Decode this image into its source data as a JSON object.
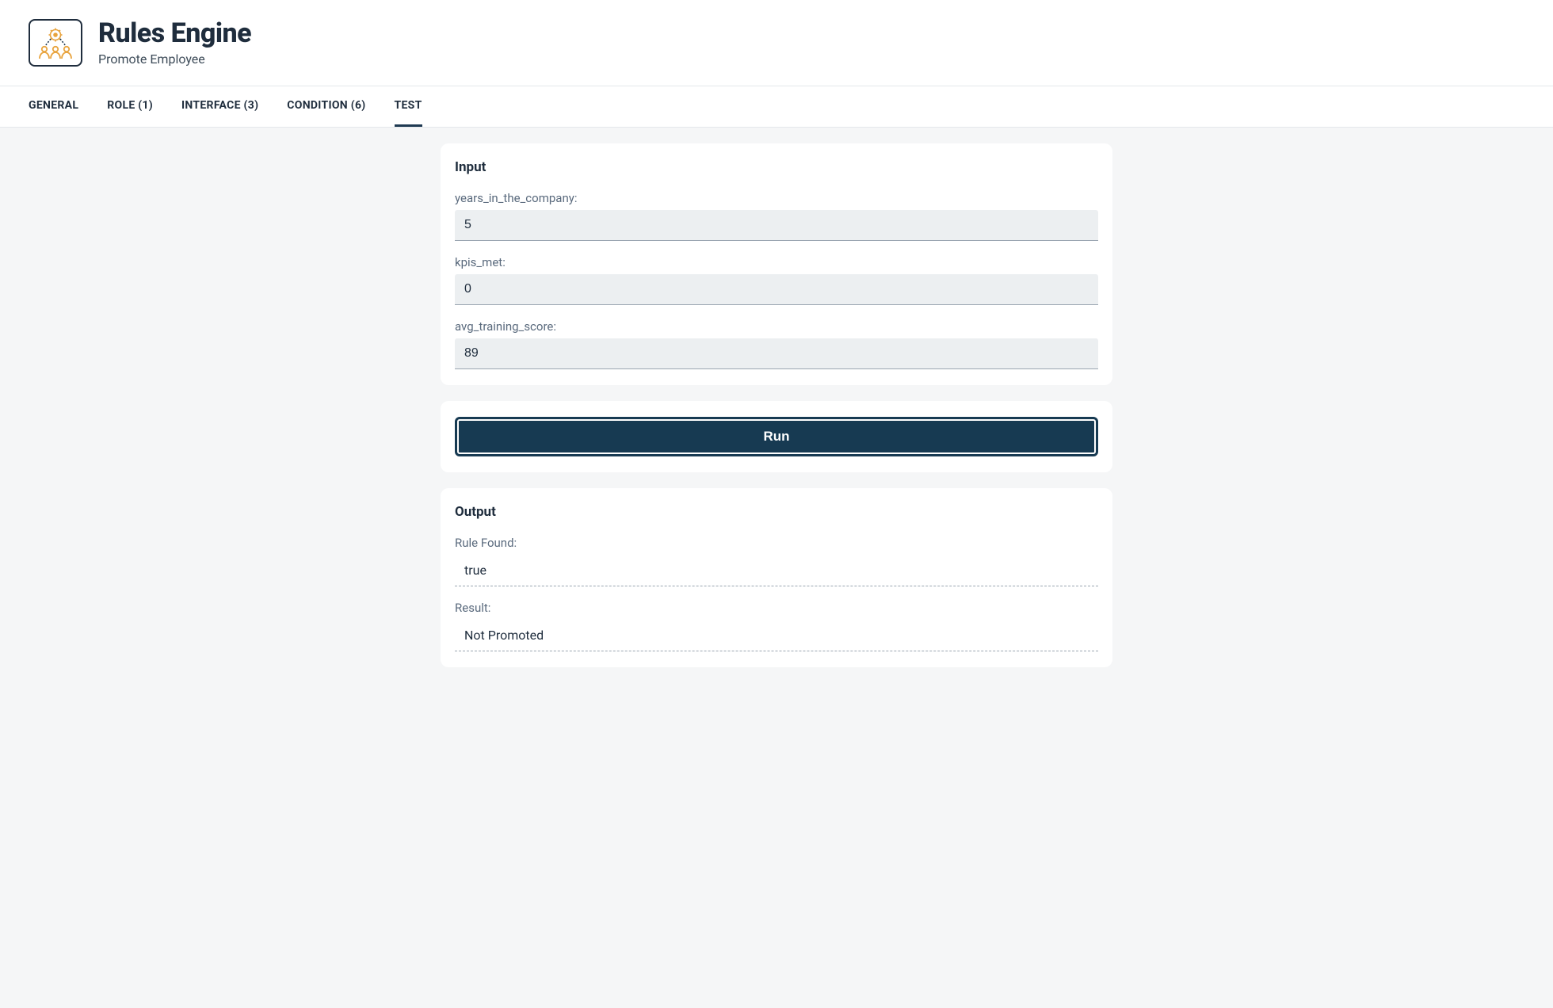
{
  "header": {
    "title": "Rules Engine",
    "subtitle": "Promote Employee"
  },
  "tabs": [
    {
      "label": "GENERAL",
      "active": false
    },
    {
      "label": "ROLE (1)",
      "active": false
    },
    {
      "label": "INTERFACE (3)",
      "active": false
    },
    {
      "label": "CONDITION (6)",
      "active": false
    },
    {
      "label": "TEST",
      "active": true
    }
  ],
  "input_card": {
    "title": "Input",
    "fields": [
      {
        "label": "years_in_the_company:",
        "value": "5"
      },
      {
        "label": "kpis_met:",
        "value": "0"
      },
      {
        "label": "avg_training_score:",
        "value": "89"
      }
    ]
  },
  "run_button_label": "Run",
  "output_card": {
    "title": "Output",
    "rows": [
      {
        "label": "Rule Found:",
        "value": "true"
      },
      {
        "label": "Result:",
        "value": "Not Promoted"
      }
    ]
  }
}
